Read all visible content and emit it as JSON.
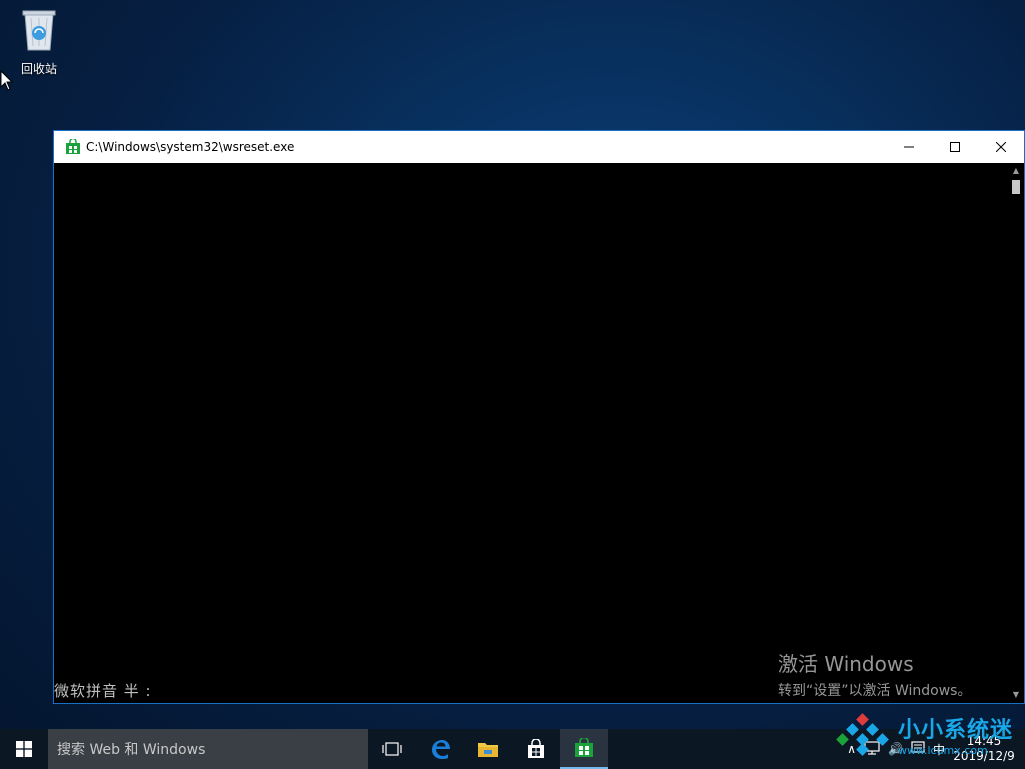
{
  "desktop": {
    "recycle_bin_label": "回收站"
  },
  "window": {
    "title": "C:\\Windows\\system32\\wsreset.exe",
    "controls": {
      "minimize": "—",
      "maximize": "☐",
      "close": "✕"
    },
    "ime_status": "微软拼音 半 :"
  },
  "watermark": {
    "line1": "激活 Windows",
    "line2": "转到“设置”以激活 Windows。"
  },
  "taskbar": {
    "search_placeholder": "搜索 Web 和 Windows",
    "tray": {
      "chevron": "∧",
      "volume": "🔊",
      "ime": "中",
      "time": "14:45",
      "date": "2019/12/9"
    }
  },
  "site_watermark": {
    "name": "小小系统迷",
    "url": "www.lcumx.com"
  },
  "colors": {
    "title_accent": "#1a6fc9",
    "store_green": "#1ba23a",
    "edge_blue": "#1a7fd8",
    "folder_yellow": "#f2c744"
  }
}
